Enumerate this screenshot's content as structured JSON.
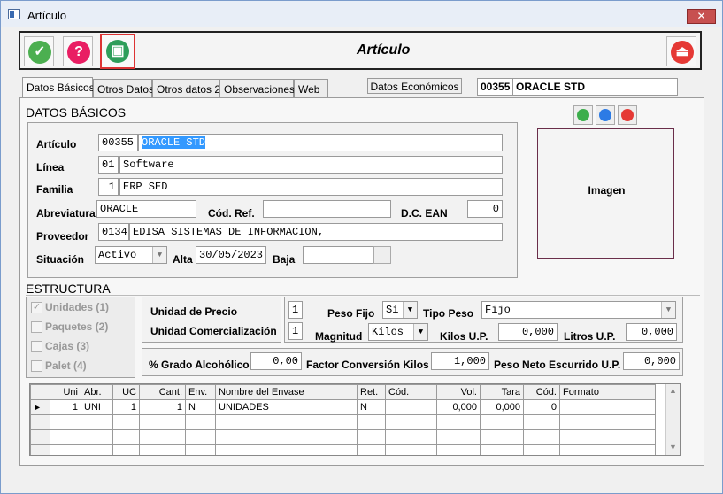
{
  "window": {
    "title": "Artículo",
    "close_glyph": "✕"
  },
  "toolbar": {
    "title": "Artículo",
    "buttons": [
      {
        "name": "accept-icon",
        "glyph": "✓",
        "color": "#4caf50"
      },
      {
        "name": "help-icon",
        "glyph": "?",
        "color": "#e91e63"
      },
      {
        "name": "boxes-icon",
        "glyph": "▣",
        "color": "#2e9e5a"
      },
      {
        "name": "exit-icon",
        "glyph": "⏏",
        "color": "#e53935"
      }
    ]
  },
  "tabs": [
    "Datos Básicos",
    "Otros Datos",
    "Otros datos 2",
    "Observaciones",
    "Web"
  ],
  "datos_economicos_button": "Datos Económicos",
  "header_code": "00355",
  "header_name": "ORACLE STD",
  "datos": {
    "heading": "DATOS BÁSICOS",
    "articulo_label": "Artículo",
    "articulo_code": "00355",
    "articulo_name": "ORACLE STD",
    "linea_label": "Línea",
    "linea_code": "01",
    "linea_name": "Software",
    "familia_label": "Familia",
    "familia_code": "1",
    "familia_name": "ERP SED",
    "abreviatura_label": "Abreviatura",
    "abreviatura": "ORACLE",
    "codref_label": "Cód. Ref.",
    "codref": "",
    "dcean_label": "D.C. EAN",
    "dcean": "0",
    "proveedor_label": "Proveedor",
    "proveedor_code": "0134",
    "proveedor_name": "EDISA SISTEMAS DE INFORMACION,",
    "situacion_label": "Situación",
    "situacion": "Activo",
    "alta_label": "Alta",
    "alta": "30/05/2023",
    "baja_label": "Baja",
    "baja": ""
  },
  "imagen_label": "Imagen",
  "estructura": {
    "heading": "ESTRUCTURA",
    "checks": [
      "Unidades (1)",
      "Paquetes (2)",
      "Cajas (3)",
      "Palet (4)"
    ],
    "unidad_precio_label": "Unidad de Precio",
    "unidad_com_label": "Unidad Comercialización",
    "unidad_precio": "1",
    "unidad_com": "1",
    "peso_fijo_label": "Peso Fijo",
    "peso_fijo": "Sí",
    "tipo_peso_label": "Tipo Peso",
    "tipo_peso": "Fijo",
    "magnitud_label": "Magnitud",
    "magnitud": "Kilos",
    "kilos_up_label": "Kilos U.P.",
    "kilos_up": "0,000",
    "litros_up_label": "Litros U.P.",
    "litros_up": "0,000",
    "grado_label": "% Grado Alcohólico",
    "grado": "0,00",
    "factor_label": "Factor Conversión Kilos",
    "factor": "1,000",
    "peso_neto_label": "Peso Neto Escurrido U.P.",
    "peso_neto": "0,000"
  },
  "grid": {
    "columns": [
      "Uni",
      "Abr.",
      "UC",
      "Cant.",
      "Env.",
      "Nombre del Envase",
      "Ret.",
      "Cód.",
      "Vol.",
      "Tara",
      "Cód.",
      "Formato"
    ],
    "rows": [
      [
        "1",
        "UNI",
        "1",
        "1",
        "N",
        "UNIDADES",
        "N",
        "",
        "0,000",
        "0,000",
        "0",
        ""
      ]
    ],
    "row_marker": "►"
  }
}
